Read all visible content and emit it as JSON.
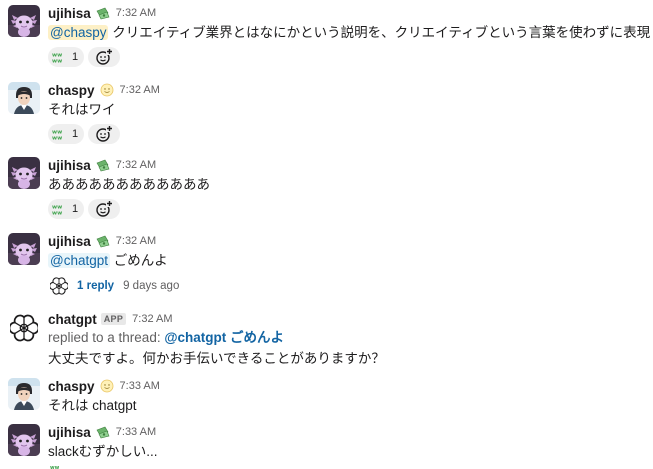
{
  "messages": [
    {
      "user": "ujihisa",
      "status_icon": "money-with-wings-emoji",
      "time": "7:32 AM",
      "mention": "@chaspy",
      "text": " クリエイティブ業界とはなにかという説明を、クリエイティブという言葉を使わずに表現",
      "reaction_icon": "www-emoji",
      "reaction_count": "1"
    },
    {
      "user": "chaspy",
      "status_icon": "slightly-smiling-face-emoji",
      "time": "7:32 AM",
      "text": "それはワイ",
      "reaction_icon": "www-emoji",
      "reaction_count": "1"
    },
    {
      "user": "ujihisa",
      "status_icon": "money-with-wings-emoji",
      "time": "7:32 AM",
      "text": "ああああああああああああ",
      "reaction_icon": "www-emoji",
      "reaction_count": "1"
    },
    {
      "user": "ujihisa",
      "status_icon": "money-with-wings-emoji",
      "time": "7:32 AM",
      "mention": "@chatgpt",
      "text": " ごめんよ",
      "reply_count": "1 reply",
      "reply_age": "9 days ago"
    },
    {
      "user": "chatgpt",
      "badge": "APP",
      "time": "7:32 AM",
      "replied_prefix": "replied to a thread: ",
      "replied_ref": "@chatgpt ごめんよ",
      "text": "大丈夫ですよ。何かお手伝いできることがありますか？"
    },
    {
      "user": "chaspy",
      "status_icon": "slightly-smiling-face-emoji",
      "time": "7:33 AM",
      "text": "それは chatgpt"
    },
    {
      "user": "ujihisa",
      "status_icon": "money-with-wings-emoji",
      "time": "7:33 AM",
      "text": "slackむずかしい..."
    }
  ],
  "colors": {
    "link": "#1264a3",
    "mention_bg": "#fdf0c6",
    "reaction_bg": "#efefef",
    "muted": "#616061"
  }
}
